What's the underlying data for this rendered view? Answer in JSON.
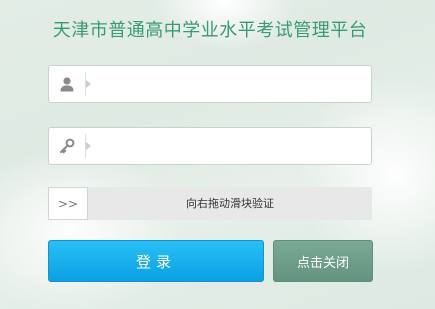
{
  "page_title": "天津市普通高中学业水平考试管理平台",
  "username": {
    "value": "",
    "placeholder": "",
    "icon": "user-icon"
  },
  "password": {
    "value": "",
    "placeholder": "",
    "icon": "key-icon"
  },
  "slider": {
    "handle_label": ">>",
    "text": "向右拖动滑块验证"
  },
  "buttons": {
    "login_label": "登录",
    "close_label": "点击关闭"
  },
  "colors": {
    "title": "#3a9a72",
    "login": "#0aa0e3",
    "close": "#64947f"
  }
}
